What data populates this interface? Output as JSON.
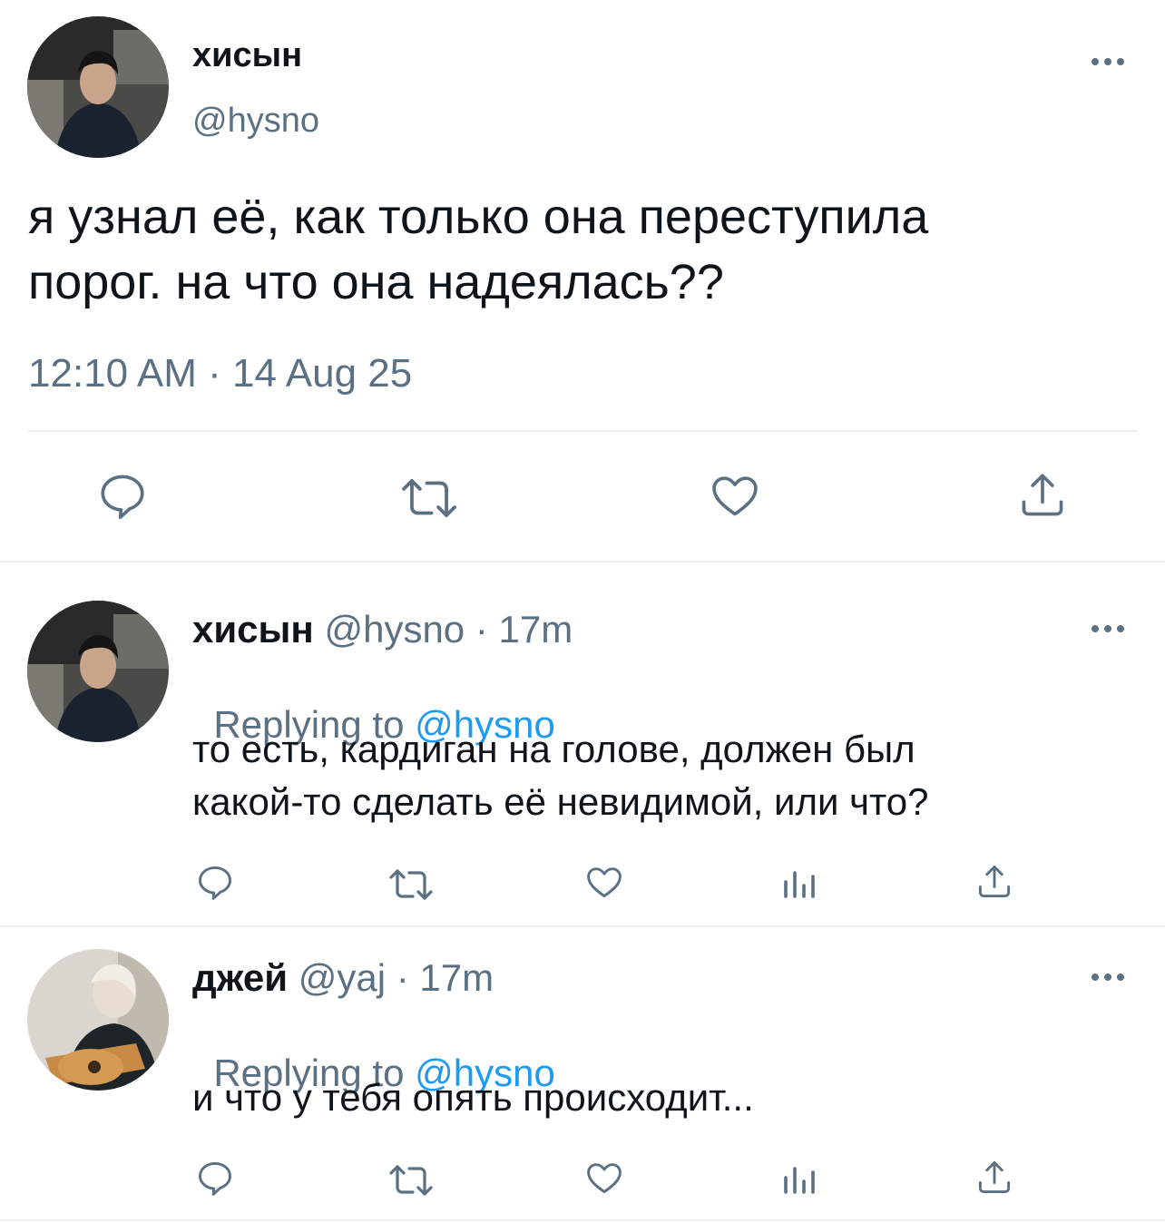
{
  "main_tweet": {
    "name": "хисын",
    "handle": "@hysno",
    "text_line1": "я узнал её, как только она переступила",
    "text_line2": "порог. на что она надеялась??",
    "timestamp": "12:10 AM · 14 Aug 25",
    "more": "•••"
  },
  "replies": [
    {
      "name": "хисын",
      "meta": "@hysno · 17m",
      "replying_prefix": "Replying to ",
      "replying_handle": "@hysno",
      "text_line1": "то есть, кардиган на голове, должен был",
      "text_line2": "какой-то сделать её невидимой, или что?",
      "more": "•••"
    },
    {
      "name": "джей",
      "meta": "@yaj · 17m",
      "replying_prefix": "Replying to ",
      "replying_handle": "@hysno",
      "text_line1": "и что у тебя опять происходит...",
      "more": "•••"
    }
  ],
  "icons": {
    "reply": "reply-icon",
    "retweet": "retweet-icon",
    "like": "heart-icon",
    "analytics": "analytics-icon",
    "share": "share-icon",
    "more": "more-icon"
  },
  "colors": {
    "text": "#0f1419",
    "secondary": "#5b7083",
    "link": "#1d9bf0",
    "divider": "#eceff1"
  }
}
